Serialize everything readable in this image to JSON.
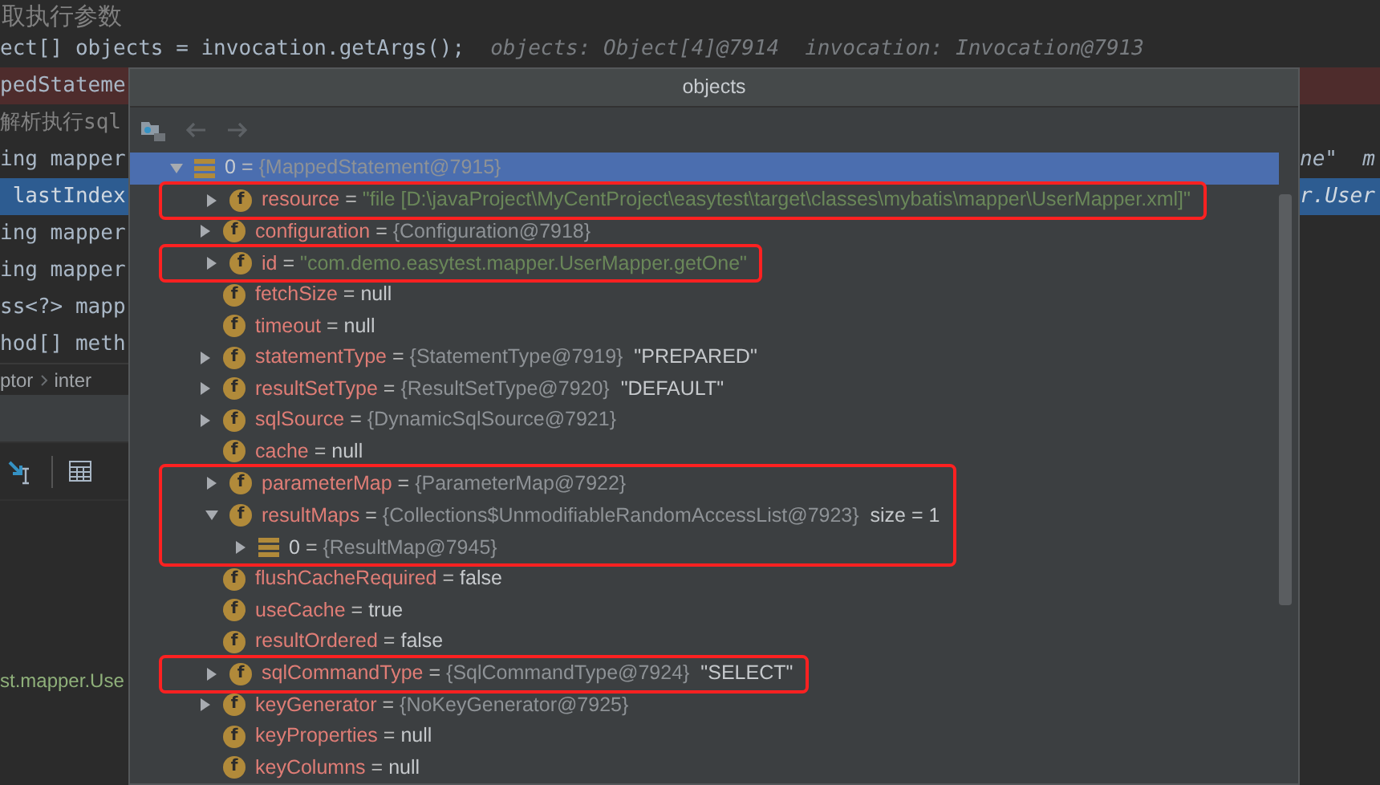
{
  "editor": {
    "comment": "取执行参数",
    "code_line": {
      "code": "ect[] objects = invocation.getArgs();",
      "hints": [
        "objects: Object[4]@7914",
        "invocation: Invocation@7913"
      ]
    },
    "lines": [
      {
        "left": "pedStateme",
        "kind": "error"
      },
      {
        "left": "解析执行sql",
        "kind": "comment"
      },
      {
        "left": "ing mapper",
        "right": "ne\"  m",
        "kind": "code"
      },
      {
        "left": " lastIndex",
        "right": "r.User",
        "kind": "current"
      },
      {
        "left": "ing mapper",
        "kind": "code"
      },
      {
        "left": "ing mapper",
        "kind": "code"
      },
      {
        "left": "ss<?> mapp",
        "kind": "code"
      },
      {
        "left": "hod[] meth",
        "kind": "code"
      }
    ],
    "breadcrumb": [
      "ptor",
      "inter"
    ],
    "bottom_text": "st.mapper.Use"
  },
  "popup": {
    "title": "objects",
    "items": [
      {
        "kind": "element",
        "name": "0",
        "eq": "=",
        "ref": "{MappedStatement@7915}",
        "expandable": true,
        "expanded": true,
        "selected": true,
        "highlighted": false,
        "children": [
          {
            "kind": "field",
            "badge": "f",
            "name": "resource",
            "eq": "=",
            "string": "\"file [D:\\javaProject\\MyCentProject\\easytest\\target\\classes\\mybatis\\mapper\\UserMapper.xml]\"",
            "expandable": true,
            "expanded": false,
            "selected": false,
            "highlighted": true
          },
          {
            "kind": "field",
            "badge": "f",
            "name": "configuration",
            "eq": "=",
            "ref": "{Configuration@7918}",
            "expandable": true,
            "expanded": false,
            "selected": false,
            "highlighted": false
          },
          {
            "kind": "field",
            "badge": "f",
            "name": "id",
            "eq": "=",
            "string": "\"com.demo.easytest.mapper.UserMapper.getOne\"",
            "expandable": true,
            "expanded": false,
            "selected": false,
            "highlighted": true
          },
          {
            "kind": "field",
            "badge": "f",
            "name": "fetchSize",
            "eq": "=",
            "value": "null",
            "expandable": false,
            "selected": false,
            "highlighted": false
          },
          {
            "kind": "field",
            "badge": "f",
            "name": "timeout",
            "eq": "=",
            "value": "null",
            "expandable": false,
            "selected": false,
            "highlighted": false
          },
          {
            "kind": "field",
            "badge": "f",
            "name": "statementType",
            "eq": "=",
            "ref": "{StatementType@7919}",
            "value": "\"PREPARED\"",
            "expandable": true,
            "expanded": false,
            "selected": false,
            "highlighted": false
          },
          {
            "kind": "field",
            "badge": "f",
            "name": "resultSetType",
            "eq": "=",
            "ref": "{ResultSetType@7920}",
            "value": "\"DEFAULT\"",
            "expandable": true,
            "expanded": false,
            "selected": false,
            "highlighted": false
          },
          {
            "kind": "field",
            "badge": "f",
            "name": "sqlSource",
            "eq": "=",
            "ref": "{DynamicSqlSource@7921}",
            "expandable": true,
            "expanded": false,
            "selected": false,
            "highlighted": false
          },
          {
            "kind": "field",
            "badge": "f",
            "name": "cache",
            "eq": "=",
            "value": "null",
            "expandable": false,
            "selected": false,
            "highlighted": false
          },
          {
            "kind": "field",
            "badge": "f",
            "name": "parameterMap",
            "eq": "=",
            "ref": "{ParameterMap@7922}",
            "expandable": true,
            "expanded": false,
            "selected": false,
            "highlighted": true
          },
          {
            "kind": "field",
            "badge": "f",
            "name": "resultMaps",
            "eq": "=",
            "ref": "{Collections$UnmodifiableRandomAccessList@7923}",
            "value": "size = 1",
            "expandable": true,
            "expanded": true,
            "selected": false,
            "highlighted": true,
            "children": [
              {
                "kind": "element",
                "name": "0",
                "eq": "=",
                "ref": "{ResultMap@7945}",
                "expandable": true,
                "expanded": false,
                "selected": false,
                "highlighted": true
              }
            ]
          },
          {
            "kind": "field",
            "badge": "f",
            "name": "flushCacheRequired",
            "eq": "=",
            "value": "false",
            "expandable": false,
            "selected": false,
            "highlighted": false
          },
          {
            "kind": "field",
            "badge": "f",
            "name": "useCache",
            "eq": "=",
            "value": "true",
            "expandable": false,
            "selected": false,
            "highlighted": false
          },
          {
            "kind": "field",
            "badge": "f",
            "name": "resultOrdered",
            "eq": "=",
            "value": "false",
            "expandable": false,
            "selected": false,
            "highlighted": false
          },
          {
            "kind": "field",
            "badge": "f",
            "name": "sqlCommandType",
            "eq": "=",
            "ref": "{SqlCommandType@7924}",
            "value": "\"SELECT\"",
            "expandable": true,
            "expanded": false,
            "selected": false,
            "highlighted": true
          },
          {
            "kind": "field",
            "badge": "f",
            "name": "keyGenerator",
            "eq": "=",
            "ref": "{NoKeyGenerator@7925}",
            "expandable": true,
            "expanded": false,
            "selected": false,
            "highlighted": false
          },
          {
            "kind": "field",
            "badge": "f",
            "name": "keyProperties",
            "eq": "=",
            "value": "null",
            "expandable": false,
            "selected": false,
            "highlighted": false
          },
          {
            "kind": "field",
            "badge": "f",
            "name": "keyColumns",
            "eq": "=",
            "value": "null",
            "expandable": false,
            "selected": false,
            "highlighted": false
          }
        ]
      }
    ]
  }
}
